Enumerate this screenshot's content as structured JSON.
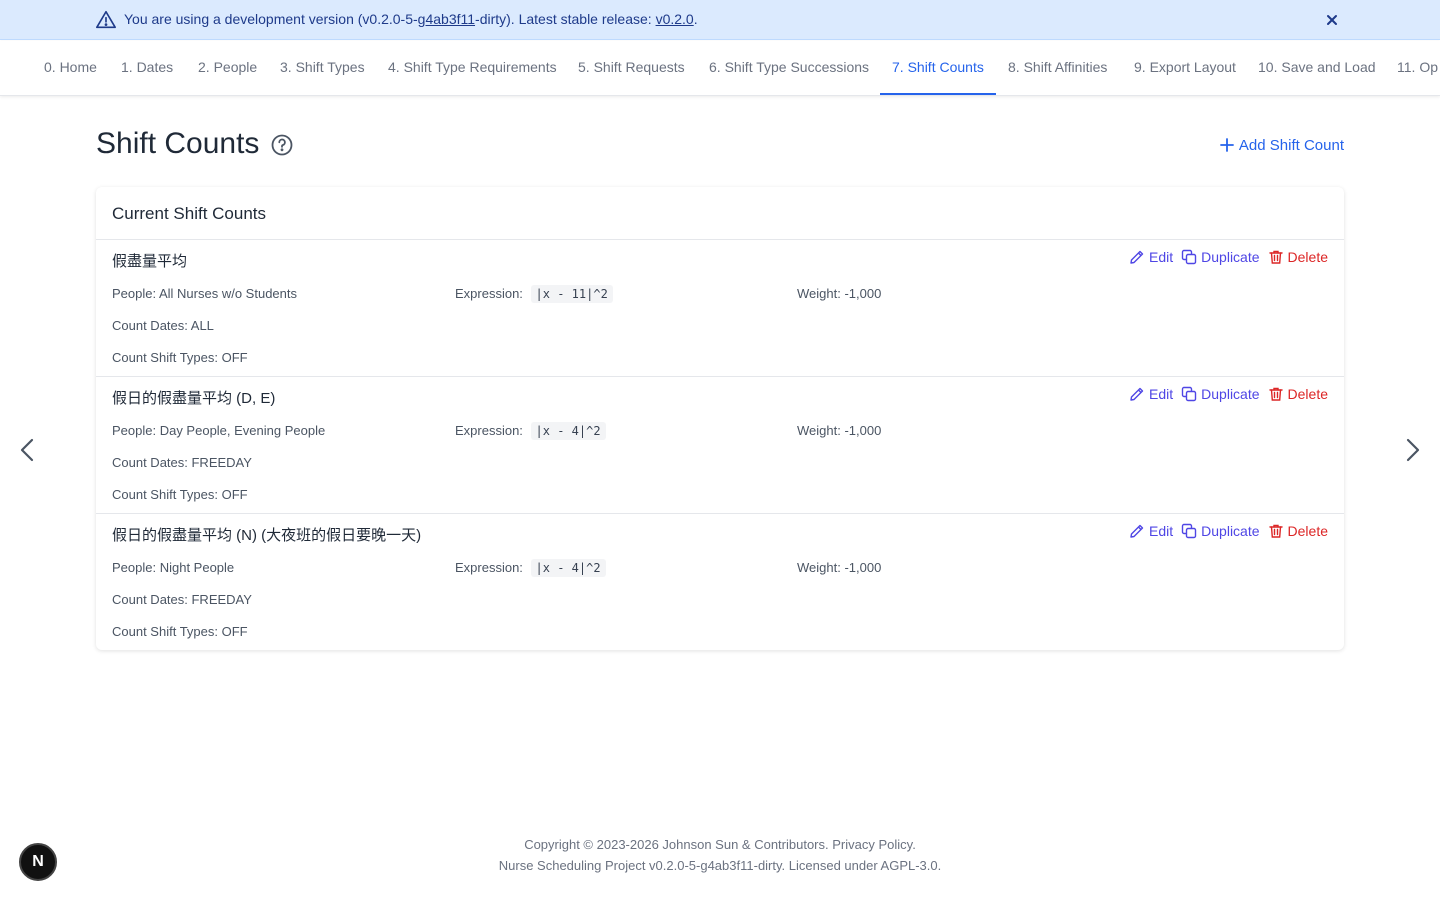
{
  "banner": {
    "prefix": "You are using a development version (v0.2.0-5-",
    "commit_link": "g4ab3f11",
    "middle": "-dirty). Latest stable release: ",
    "release_link": "v0.2.0",
    "suffix": "."
  },
  "tabs": [
    {
      "label": "0. Home"
    },
    {
      "label": "1. Dates"
    },
    {
      "label": "2. People"
    },
    {
      "label": "3. Shift Types"
    },
    {
      "label": "4. Shift Type Requirements"
    },
    {
      "label": "5. Shift Requests"
    },
    {
      "label": "6. Shift Type Successions"
    },
    {
      "label": "7. Shift Counts"
    },
    {
      "label": "8. Shift Affinities"
    },
    {
      "label": "9. Export Layout"
    },
    {
      "label": "10. Save and Load"
    },
    {
      "label": "11. Op"
    }
  ],
  "page": {
    "title": "Shift Counts",
    "add_label": "Add Shift Count",
    "card_title": "Current Shift Counts"
  },
  "labels": {
    "edit": "Edit",
    "duplicate": "Duplicate",
    "delete": "Delete"
  },
  "items": [
    {
      "title": "假盡量平均",
      "people": "People: All Nurses w/o Students",
      "expression_label": "Expression:",
      "expression": "|x - 11|^2",
      "weight": "Weight: -1,000",
      "count_dates": "Count Dates: ALL",
      "count_shift_types": "Count Shift Types: OFF"
    },
    {
      "title": "假日的假盡量平均 (D, E)",
      "people": "People: Day People, Evening People",
      "expression_label": "Expression:",
      "expression": "|x - 4|^2",
      "weight": "Weight: -1,000",
      "count_dates": "Count Dates: FREEDAY",
      "count_shift_types": "Count Shift Types: OFF"
    },
    {
      "title": "假日的假盡量平均 (N) (大夜班的假日要晚一天)",
      "people": "People: Night People",
      "expression_label": "Expression:",
      "expression": "|x - 4|^2",
      "weight": "Weight: -1,000",
      "count_dates": "Count Dates: FREEDAY",
      "count_shift_types": "Count Shift Types: OFF"
    }
  ],
  "footer": {
    "copyright": "Copyright © 2023-2026 Johnson Sun & Contributors.",
    "privacy": "Privacy Policy.",
    "version_line": "Nurse Scheduling Project v0.2.0-5-g4ab3f11-dirty. Licensed under AGPL-3.0."
  },
  "avatar": {
    "letter": "N"
  },
  "colors": {
    "accent": "#2563eb",
    "edit": "#4f46e5",
    "delete": "#dc2626",
    "banner_bg": "#dbeafe"
  }
}
